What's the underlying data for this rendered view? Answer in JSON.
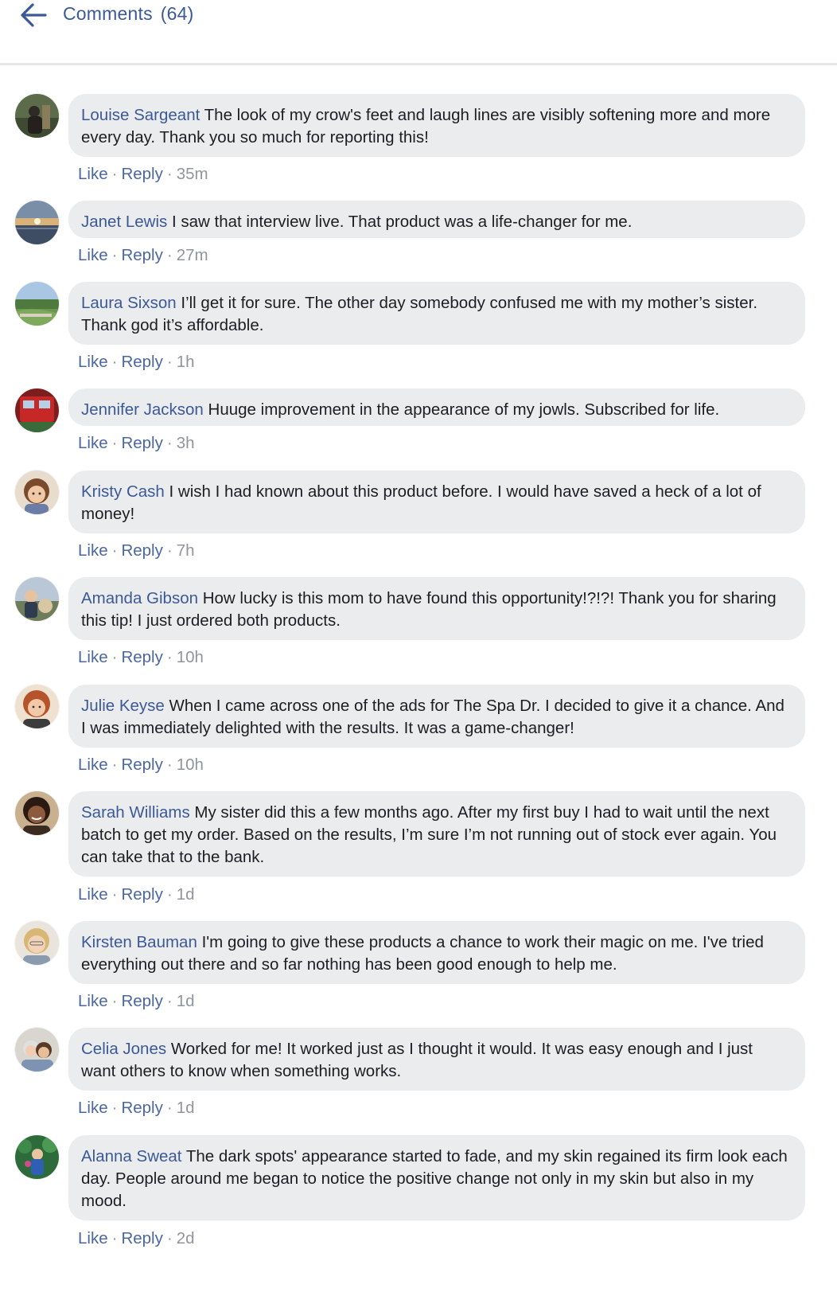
{
  "header": {
    "back_icon": "arrow-left-icon",
    "title": "Comments",
    "count": "(64)"
  },
  "colors": {
    "link": "#3b5998",
    "bubble": "#ebeced",
    "meta": "#90949c"
  },
  "actions": {
    "like": "Like",
    "reply": "Reply",
    "separator": "·"
  },
  "comments": [
    {
      "author": "Louise Sargeant",
      "text": "The look of my crow's feet and laugh lines are visibly softening more and more every day. Thank you so much for reporting this!",
      "time": "35m"
    },
    {
      "author": "Janet Lewis",
      "text": "I saw that interview live. That product was a life-changer for me.",
      "time": "27m"
    },
    {
      "author": "Laura Sixson",
      "text": "I’ll get it for sure. The other day somebody confused me with my mother’s sister. Thank god it’s affordable.",
      "time": "1h"
    },
    {
      "author": "Jennifer Jackson",
      "text": "Huuge improvement in the appearance of my jowls. Subscribed for life.",
      "time": "3h"
    },
    {
      "author": "Kristy Cash",
      "text": "I wish I had known about this product before. I would have saved a heck of a lot of money!",
      "time": "7h"
    },
    {
      "author": "Amanda Gibson",
      "text": "How lucky is this mom to have found this opportunity!?!?! Thank you for sharing this tip! I just ordered both products.",
      "time": "10h"
    },
    {
      "author": "Julie Keyse",
      "text": "When I came across one of the ads for The Spa Dr. I decided to give it a chance. And I was immediately delighted with the results. It was a game-changer!",
      "time": "10h"
    },
    {
      "author": "Sarah Williams",
      "text": "My sister did this a few months ago. After my first buy I had to wait until the next batch to get my order. Based on the results, I’m sure I’m not running out of stock ever again. You can take that to the bank.",
      "time": "1d"
    },
    {
      "author": "Kirsten Bauman",
      "text": "I'm going to give these products a chance to work their magic on me. I've tried everything out there and so far nothing has been good enough to help me.",
      "time": "1d"
    },
    {
      "author": "Celia Jones",
      "text": "Worked for me! It worked just as I thought it would. It was easy enough and I just want others to know when something works.",
      "time": "1d"
    },
    {
      "author": "Alanna Sweat",
      "text": "The dark spots' appearance started to fade, and my skin regained its firm look each day. People around me began to notice the positive change not only in my skin but also in my mood.",
      "time": "2d"
    }
  ]
}
